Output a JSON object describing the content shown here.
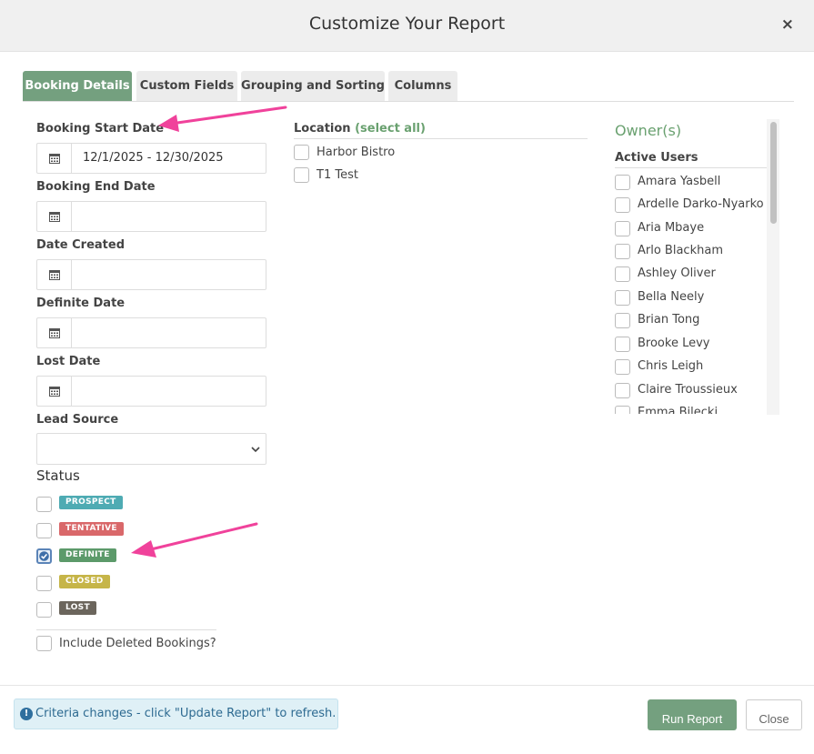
{
  "modal": {
    "title": "Customize Your Report",
    "close_glyph": "×"
  },
  "tabs": [
    {
      "label": "Booking Details",
      "active": true
    },
    {
      "label": "Custom Fields",
      "active": false
    },
    {
      "label": "Grouping and Sorting",
      "active": false
    },
    {
      "label": "Columns",
      "active": false
    }
  ],
  "dates": {
    "booking_start": {
      "label": "Booking Start Date",
      "value": "12/1/2025 - 12/30/2025"
    },
    "booking_end": {
      "label": "Booking End Date",
      "value": ""
    },
    "date_created": {
      "label": "Date Created",
      "value": ""
    },
    "definite_date": {
      "label": "Definite Date",
      "value": ""
    },
    "lost_date": {
      "label": "Lost Date",
      "value": ""
    }
  },
  "lead_source": {
    "label": "Lead Source",
    "value": ""
  },
  "status": {
    "title": "Status",
    "items": [
      {
        "label": "PROSPECT",
        "color": "#4eabb3",
        "checked": false
      },
      {
        "label": "TENTATIVE",
        "color": "#d9686a",
        "checked": false
      },
      {
        "label": "DEFINITE",
        "color": "#5c9a6a",
        "checked": true
      },
      {
        "label": "CLOSED",
        "color": "#c6b548",
        "checked": false
      },
      {
        "label": "LOST",
        "color": "#6b655c",
        "checked": false
      }
    ]
  },
  "include_deleted": {
    "label": "Include Deleted Bookings?",
    "checked": false
  },
  "location": {
    "title": "Location",
    "select_all": "(select all)",
    "items": [
      "Harbor Bistro",
      "T1 Test"
    ]
  },
  "owners": {
    "title": "Owner(s)",
    "group": "Active Users",
    "items": [
      "Amara Yasbell",
      "Ardelle Darko-Nyarko",
      "Aria Mbaye",
      "Arlo Blackham",
      "Ashley Oliver",
      "Bella Neely",
      "Brian Tong",
      "Brooke Levy",
      "Chris Leigh",
      "Claire Troussieux",
      "Emma Bilecki"
    ]
  },
  "footer": {
    "info_icon": "!",
    "info_text": "Criteria changes - click \"Update Report\" to refresh.",
    "run_label": "Run Report",
    "close_label": "Close"
  },
  "colors": {
    "accent": "#74a07f",
    "arrow": "#f0429b",
    "link": "#6aa170"
  }
}
